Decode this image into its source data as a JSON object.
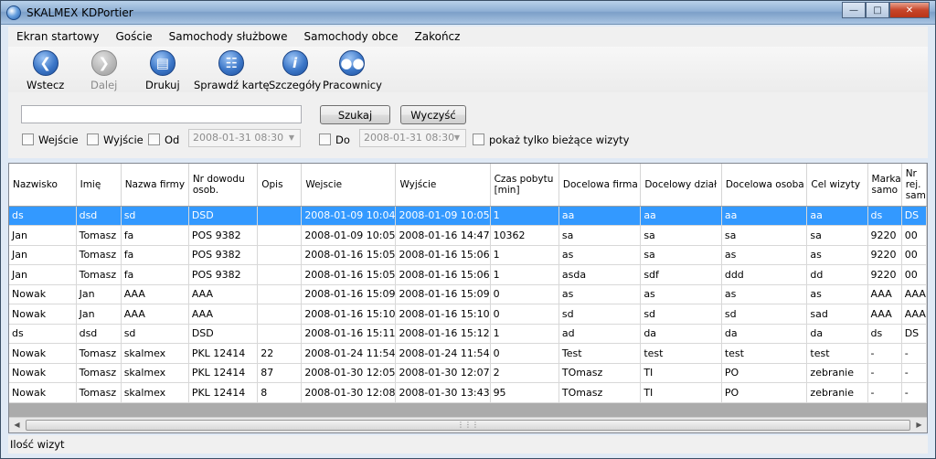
{
  "window": {
    "title": "SKALMEX KDPortier"
  },
  "menu": [
    "Ekran startowy",
    "Goście",
    "Samochody służbowe",
    "Samochody obce",
    "Zakończ"
  ],
  "toolbar": {
    "back": "Wstecz",
    "forward": "Dalej",
    "print": "Drukuj",
    "check_card": "Sprawdź kartę",
    "details": "Szczegóły",
    "employees": "Pracownicy"
  },
  "filter": {
    "search_value": "",
    "search_button": "Szukaj",
    "clear_button": "Wyczyść",
    "entries_label": "Wejście",
    "exits_label": "Wyjście",
    "from_label": "Od",
    "from_date": "2008-01-31 08:30",
    "to_label": "Do",
    "to_date": "2008-01-31 08:30",
    "current_only_label": "pokaż tylko bieżące wizyty"
  },
  "table": {
    "columns": [
      "Nazwisko",
      "Imię",
      "Nazwa firmy",
      "Nr dowodu osob.",
      "Opis",
      "Wejscie",
      "Wyjście",
      "Czas pobytu [min]",
      "Docelowa firma",
      "Docelowy dział",
      "Docelowa osoba",
      "Cel wizyty",
      "Marka samo",
      "Nr rej. sam"
    ],
    "rows": [
      [
        "ds",
        "dsd",
        "sd",
        "DSD",
        "",
        "2008-01-09 10:04",
        "2008-01-09 10:05",
        "1",
        "aa",
        "aa",
        "aa",
        "aa",
        "ds",
        "DS"
      ],
      [
        "Jan",
        "Tomasz",
        "fa",
        "POS 9382",
        "",
        "2008-01-09 10:05",
        "2008-01-16 14:47",
        "10362",
        "sa",
        "sa",
        "sa",
        "sa",
        "9220",
        "00"
      ],
      [
        "Jan",
        "Tomasz",
        "fa",
        "POS 9382",
        "",
        "2008-01-16 15:05",
        "2008-01-16 15:06",
        "1",
        "as",
        "sa",
        "as",
        "as",
        "9220",
        "00"
      ],
      [
        "Jan",
        "Tomasz",
        "fa",
        "POS 9382",
        "",
        "2008-01-16 15:05",
        "2008-01-16 15:06",
        "1",
        "asda",
        "sdf",
        "ddd",
        "dd",
        "9220",
        "00"
      ],
      [
        "Nowak",
        "Jan",
        "AAA",
        "AAA",
        "",
        "2008-01-16 15:09",
        "2008-01-16 15:09",
        "0",
        "as",
        "as",
        "as",
        "as",
        "AAA",
        "AAA"
      ],
      [
        "Nowak",
        "Jan",
        "AAA",
        "AAA",
        "",
        "2008-01-16 15:10",
        "2008-01-16 15:10",
        "0",
        "sd",
        "sd",
        "sd",
        "sad",
        "AAA",
        "AAA"
      ],
      [
        "ds",
        "dsd",
        "sd",
        "DSD",
        "",
        "2008-01-16 15:11",
        "2008-01-16 15:12",
        "1",
        "ad",
        "da",
        "da",
        "da",
        "ds",
        "DS"
      ],
      [
        "Nowak",
        "Tomasz",
        "skalmex",
        "PKL 12414",
        "22",
        "2008-01-24 11:54",
        "2008-01-24 11:54",
        "0",
        "Test",
        "test",
        "test",
        "test",
        "-",
        "-"
      ],
      [
        "Nowak",
        "Tomasz",
        "skalmex",
        "PKL 12414",
        "87",
        "2008-01-30 12:05",
        "2008-01-30 12:07",
        "2",
        "TOmasz",
        "TI",
        "PO",
        "zebranie",
        "-",
        "-"
      ],
      [
        "Nowak",
        "Tomasz",
        "skalmex",
        "PKL 12414",
        "8",
        "2008-01-30 12:08",
        "2008-01-30 13:43",
        "95",
        "TOmasz",
        "TI",
        "PO",
        "zebranie",
        "-",
        "-"
      ]
    ],
    "selected_row": 0
  },
  "status": {
    "text": "Ilość wizyt"
  },
  "colors": {
    "selection": "#3399ff",
    "window_frame": "#dfe9f5"
  }
}
